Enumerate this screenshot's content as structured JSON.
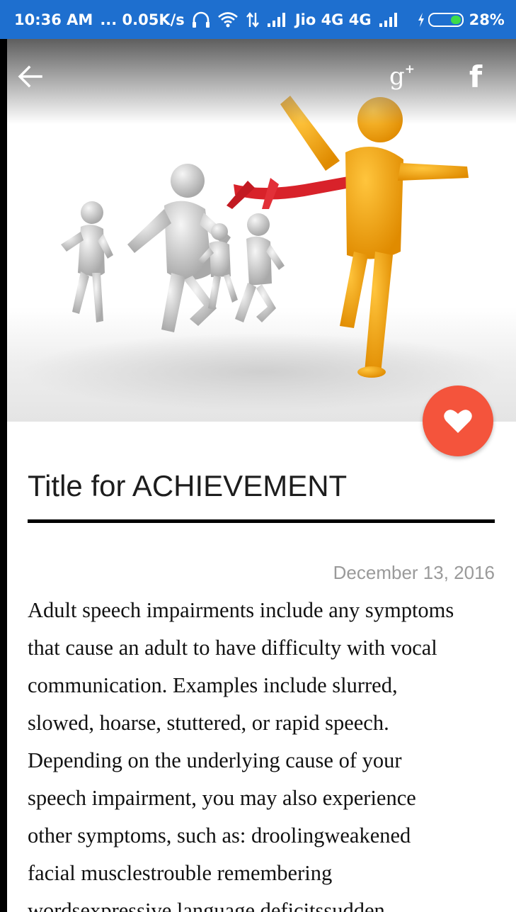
{
  "status_bar": {
    "time": "10:36 AM",
    "speed": "... 0.05K/s",
    "carrier": "Jio 4G 4G",
    "battery": "28%",
    "battery_level": 0.28,
    "icons": [
      "headset-icon",
      "wifi-icon",
      "data-arrows-icon",
      "signal-icon",
      "signal-icon",
      "charging-icon",
      "battery-icon"
    ]
  },
  "toolbar": {
    "back_icon": "arrow-left-icon",
    "gplus_label": "g",
    "gplus_sup": "+",
    "facebook_label": "f"
  },
  "hero": {
    "image": "achievement-illustration",
    "fab_icon": "heart-icon",
    "colors": {
      "fab": "#f4543c",
      "winner": "#f2a516",
      "ribbon": "#d8222a",
      "runners": "#c9c9c9"
    }
  },
  "article": {
    "title": "Title for ACHIEVEMENT",
    "date": "December 13, 2016",
    "body_lines": [
      "Adult speech impairments include any symptoms",
      "that cause an adult to have difficulty with vocal",
      "communication. Examples include slurred,",
      "slowed, hoarse, stuttered, or rapid speech.",
      "Depending on the underlying cause of your",
      "speech impairment, you may also experience",
      "other symptoms, such as: droolingweakened",
      "facial musclestrouble remembering",
      "wordsexpressive language deficitssudden"
    ]
  }
}
